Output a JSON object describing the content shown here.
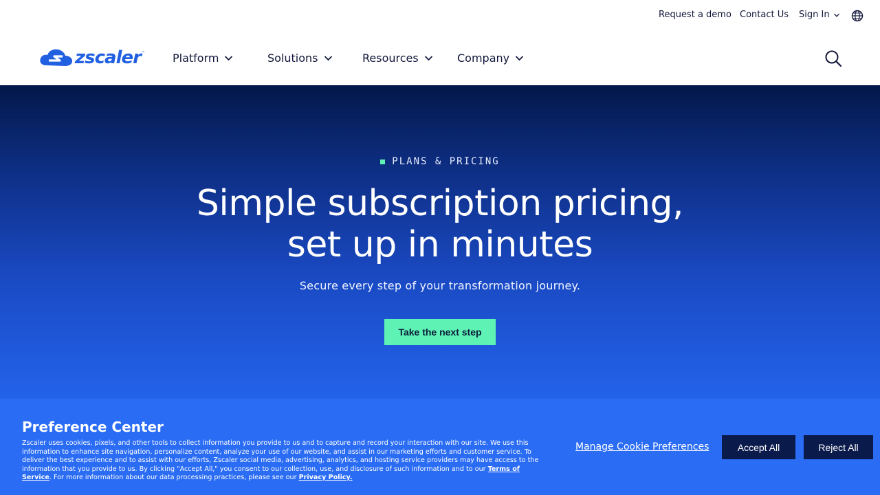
{
  "utility_bar": {
    "request_demo": "Request a demo",
    "contact_us": "Contact Us",
    "sign_in": "Sign In"
  },
  "logo": {
    "text": "zscaler",
    "tm": "™"
  },
  "nav": {
    "items": [
      {
        "label": "Platform"
      },
      {
        "label": "Solutions"
      },
      {
        "label": "Resources"
      },
      {
        "label": "Company"
      }
    ]
  },
  "hero": {
    "eyebrow": "PLANS & PRICING",
    "title_line1": "Simple subscription pricing,",
    "title_line2": "set up in minutes",
    "subtitle": "Secure every step of your transformation journey.",
    "cta": "Take the next step"
  },
  "cookie_banner": {
    "title": "Preference Center",
    "body_part1": "Zscaler uses cookies, pixels, and other tools to collect information you provide to us and to capture and record your interaction with our site. We use this information to enhance site navigation, personalize content, analyze your use of our website, and assist in our marketing efforts and customer service. To deliver the best experience and to assist with our efforts, Zscaler social media, advertising, analytics, and hosting service providers may have access to the information that you provide to us. By clicking \"Accept All,\" you consent to our collection, use, and disclosure of such information and to our ",
    "terms_link": "Terms of Service",
    "body_part2": ". For more information about our data processing practices, please see our ",
    "privacy_link": "Privacy Policy.",
    "manage": "Manage Cookie Preferences",
    "accept": "Accept All",
    "reject": "Reject All"
  },
  "colors": {
    "brand_blue": "#2160e1",
    "cta_green": "#5ef2b4",
    "hero_top": "#031849",
    "hero_bottom": "#2363ea",
    "cookie_bg": "#2a6cf4",
    "button_dark": "#0a1a4a"
  },
  "icons": [
    "chevron-down-icon",
    "globe-icon",
    "search-icon",
    "zscaler-cloud-logo"
  ]
}
